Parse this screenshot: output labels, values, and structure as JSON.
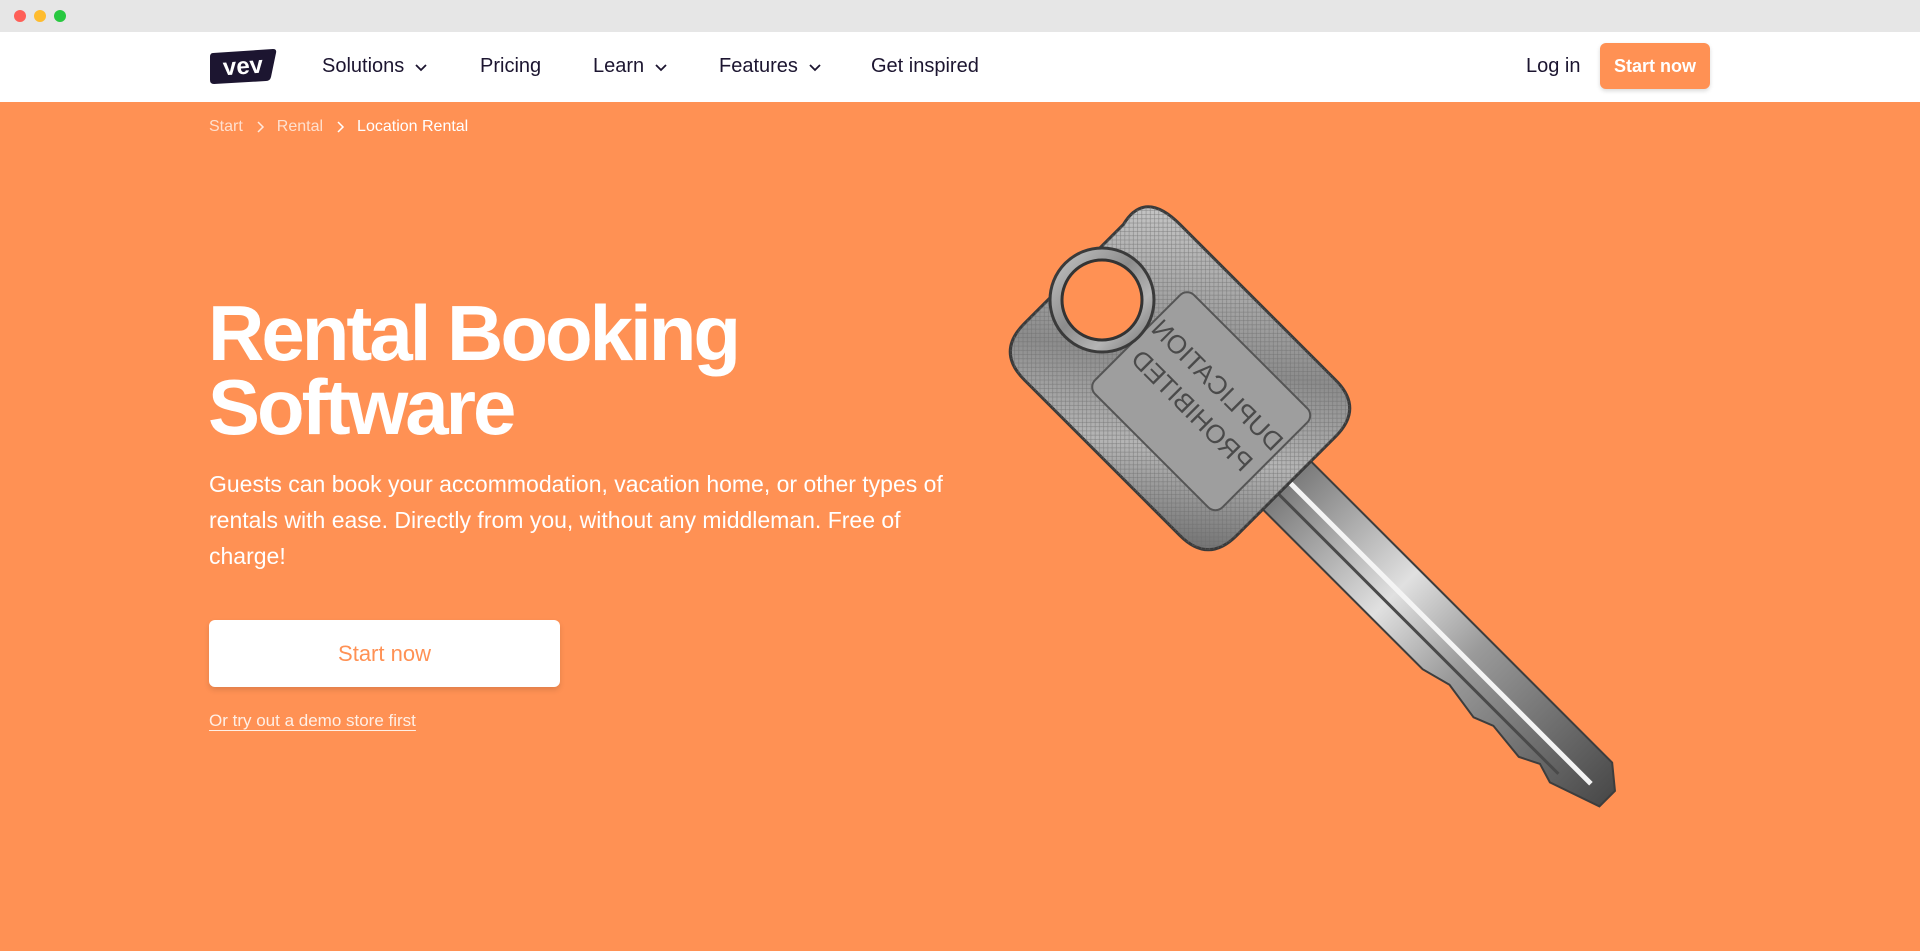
{
  "window": {
    "controls": [
      "close",
      "minimize",
      "maximize"
    ]
  },
  "brand": {
    "logo_text": "vev",
    "accent": "#ff9154",
    "dark": "#1c1530"
  },
  "nav": {
    "items": [
      {
        "label": "Solutions",
        "has_dropdown": true
      },
      {
        "label": "Pricing",
        "has_dropdown": false
      },
      {
        "label": "Learn",
        "has_dropdown": true
      },
      {
        "label": "Features",
        "has_dropdown": true
      },
      {
        "label": "Get inspired",
        "has_dropdown": false
      }
    ],
    "login_label": "Log in",
    "start_label": "Start now"
  },
  "breadcrumb": [
    "Start",
    "Rental",
    "Location Rental"
  ],
  "hero": {
    "title_line1": "Rental Booking",
    "title_line2": "Software",
    "description": "Guests can book your accommodation, vacation home, or other types of rentals with ease. Directly from you, without any middleman. Free of charge!",
    "cta_label": "Start now",
    "demo_link": "Or try out a demo store first",
    "image_text": "DUPLICATION PROHIBITED"
  }
}
